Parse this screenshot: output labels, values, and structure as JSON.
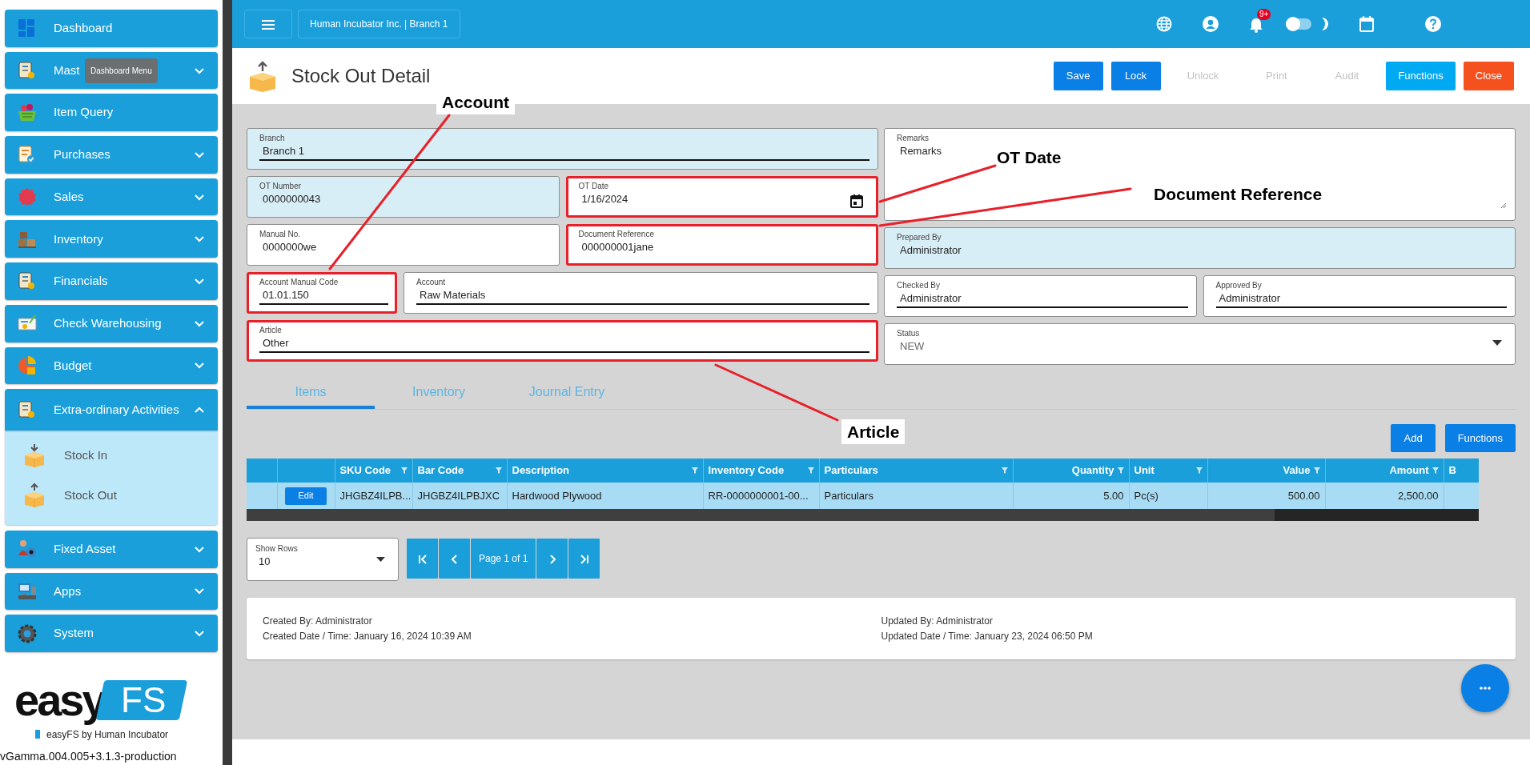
{
  "sidebar": {
    "items": [
      {
        "label": "Dashboard",
        "kind": "link"
      },
      {
        "label": "Mast",
        "kind": "menu",
        "expanded": false,
        "tooltip": "Dashboard Menu"
      },
      {
        "label": "Item Query",
        "kind": "link"
      },
      {
        "label": "Purchases",
        "kind": "menu",
        "expanded": false
      },
      {
        "label": "Sales",
        "kind": "menu",
        "expanded": false
      },
      {
        "label": "Inventory",
        "kind": "menu",
        "expanded": false
      },
      {
        "label": "Financials",
        "kind": "menu",
        "expanded": false
      },
      {
        "label": "Check Warehousing",
        "kind": "menu",
        "expanded": false
      },
      {
        "label": "Budget",
        "kind": "menu",
        "expanded": false
      },
      {
        "label": "Extra-ordinary Activities",
        "kind": "menu",
        "expanded": true,
        "children": [
          {
            "label": "Stock In"
          },
          {
            "label": "Stock Out"
          }
        ]
      },
      {
        "label": "Fixed Asset",
        "kind": "menu",
        "expanded": false
      },
      {
        "label": "Apps",
        "kind": "menu",
        "expanded": false
      },
      {
        "label": "System",
        "kind": "menu",
        "expanded": false
      }
    ],
    "logo_word": "easy",
    "logo_badge": "FS",
    "byline": "easyFS by Human Incubator",
    "version": "vGamma.004.005+3.1.3-production"
  },
  "header": {
    "company": "Human Incubator Inc. | Branch 1",
    "notification_count": "9+",
    "dark_mode": false
  },
  "page": {
    "title": "Stock Out Detail",
    "buttons": [
      {
        "label": "Save",
        "disabled": false
      },
      {
        "label": "Lock",
        "disabled": false
      },
      {
        "label": "Unlock",
        "disabled": true
      },
      {
        "label": "Print",
        "disabled": true
      },
      {
        "label": "Audit",
        "disabled": true
      },
      {
        "label": "Functions",
        "disabled": false
      },
      {
        "label": "Close",
        "disabled": false
      }
    ]
  },
  "form": {
    "left": [
      [
        {
          "label": "Branch",
          "value": "Branch 1",
          "kind": "text",
          "shaded": true,
          "underline": true,
          "highlighted": false
        }
      ],
      [
        {
          "label": "OT Number",
          "value": "0000000043",
          "kind": "text",
          "shaded": true,
          "underline": false,
          "highlighted": false
        },
        {
          "label": "OT Date",
          "value": "1/16/2024",
          "kind": "date",
          "shaded": false,
          "underline": false,
          "highlighted": true
        }
      ],
      [
        {
          "label": "Manual No.",
          "value": "0000000we",
          "kind": "text",
          "shaded": false,
          "underline": false,
          "highlighted": false
        },
        {
          "label": "Document Reference",
          "value": "000000001jane",
          "kind": "text",
          "shaded": false,
          "underline": false,
          "highlighted": true
        }
      ],
      [
        {
          "label": "Account Manual Code",
          "value": "01.01.150",
          "kind": "code",
          "shaded": false,
          "underline": true,
          "highlighted": true
        },
        {
          "label": "Account",
          "value": "Raw Materials",
          "kind": "text",
          "shaded": false,
          "underline": true,
          "highlighted": false
        }
      ],
      [
        {
          "label": "Article",
          "value": "Other",
          "kind": "text",
          "shaded": false,
          "underline": true,
          "highlighted": true
        }
      ]
    ],
    "right": [
      [
        {
          "label": "Remarks",
          "value": "Remarks",
          "kind": "textarea",
          "shaded": false,
          "underline": false,
          "highlighted": false
        }
      ],
      [
        {
          "label": "Prepared By",
          "value": "Administrator",
          "kind": "text",
          "shaded": true,
          "underline": false,
          "highlighted": false
        }
      ],
      [
        {
          "label": "Checked By",
          "value": "Administrator",
          "kind": "text",
          "shaded": false,
          "underline": true,
          "highlighted": false
        },
        {
          "label": "Approved By",
          "value": "Administrator",
          "kind": "text",
          "shaded": false,
          "underline": true,
          "highlighted": false
        }
      ],
      [
        {
          "label": "Status",
          "value": "NEW",
          "kind": "select",
          "shaded": false,
          "underline": false,
          "highlighted": false
        }
      ]
    ]
  },
  "tabs": [
    {
      "label": "Items",
      "selected": true
    },
    {
      "label": "Inventory",
      "selected": false
    },
    {
      "label": "Journal Entry",
      "selected": false
    }
  ],
  "grid": {
    "buttons": [
      "Add",
      "Functions"
    ],
    "columns": [
      {
        "kind": "blank"
      },
      {
        "kind": "action"
      },
      {
        "kind": "data",
        "label": "SKU Code",
        "filter": true,
        "numeric": false
      },
      {
        "kind": "data",
        "label": "Bar Code",
        "filter": true,
        "numeric": false
      },
      {
        "kind": "data",
        "label": "Description",
        "filter": true,
        "numeric": false
      },
      {
        "kind": "data",
        "label": "Inventory Code",
        "filter": true,
        "numeric": false
      },
      {
        "kind": "data",
        "label": "Particulars",
        "filter": true,
        "numeric": false
      },
      {
        "kind": "data",
        "label": "Quantity",
        "filter": true,
        "numeric": true
      },
      {
        "kind": "data",
        "label": "Unit",
        "filter": true,
        "numeric": false
      },
      {
        "kind": "data",
        "label": "Value",
        "filter": true,
        "numeric": true
      },
      {
        "kind": "data",
        "label": "Amount",
        "filter": true,
        "numeric": true
      },
      {
        "kind": "data",
        "label": "B",
        "filter": false,
        "numeric": false
      }
    ],
    "rows": [
      {
        "selected": true,
        "cells": [
          "",
          "Edit",
          "JHGBZ4ILPB...",
          "JHGBZ4ILPBJXC",
          "Hardwood Plywood",
          "RR-0000000001-00...",
          "Particulars",
          "5.00",
          "Pc(s)",
          "500.00",
          "2,500.00",
          ""
        ]
      }
    ]
  },
  "pager": {
    "show_rows_label": "Show Rows",
    "show_rows_value": "10",
    "page_label": "Page 1 of 1"
  },
  "audit": {
    "left": [
      "Created By: Administrator",
      "Created Date / Time: January 16, 2024 10:39 AM"
    ],
    "right": [
      "Updated By: Administrator",
      "Updated Date / Time: January 23, 2024 06:50 PM"
    ]
  },
  "annotations": [
    {
      "label": "Account"
    },
    {
      "label": "OT Date"
    },
    {
      "label": "Document Reference"
    },
    {
      "label": "Article"
    }
  ]
}
